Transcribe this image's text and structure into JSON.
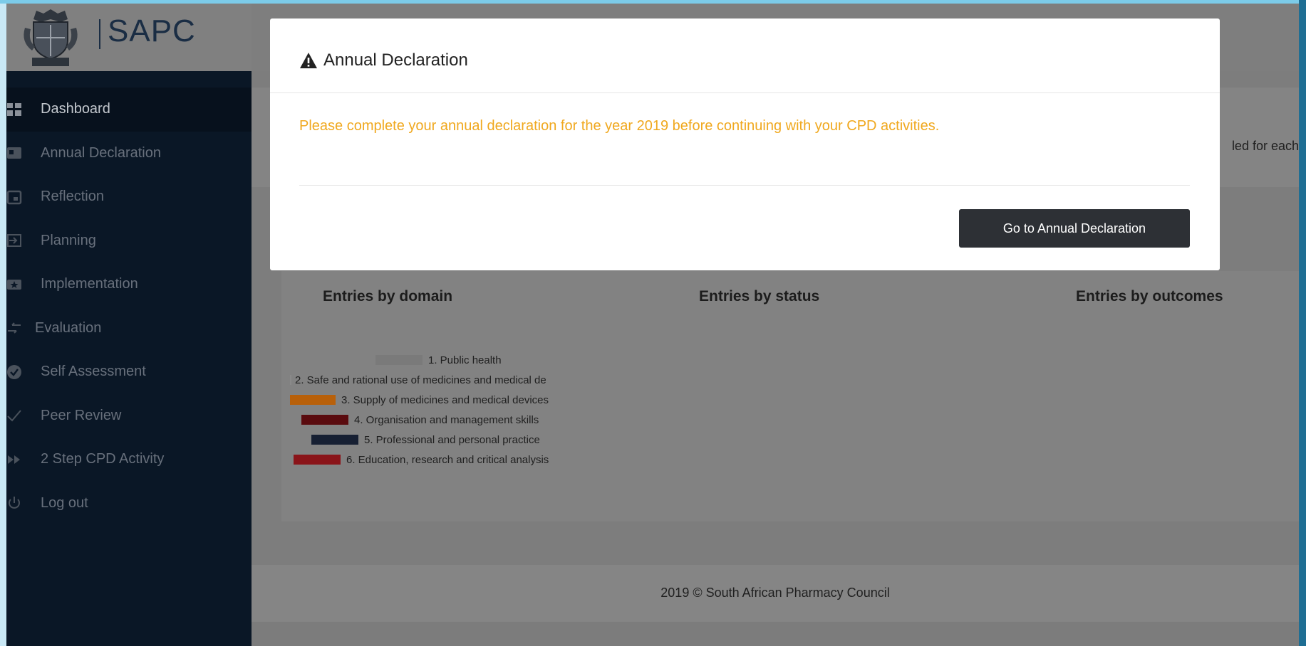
{
  "brand": {
    "name": "SAPC",
    "crest_text": "South African Pharmacy Council"
  },
  "sidebar": {
    "items": [
      {
        "label": "Dashboard",
        "icon": "grid-icon",
        "active": true
      },
      {
        "label": "Annual Declaration",
        "icon": "id-card-icon",
        "active": false
      },
      {
        "label": "Reflection",
        "icon": "calendar-icon",
        "active": false
      },
      {
        "label": "Planning",
        "icon": "sign-in-icon",
        "active": false
      },
      {
        "label": "Implementation",
        "icon": "star-icon",
        "active": false
      },
      {
        "label": "Evaluation",
        "icon": "exchange-icon",
        "active": false
      },
      {
        "label": "Self Assessment",
        "icon": "check-circle-icon",
        "active": false
      },
      {
        "label": "Peer Review",
        "icon": "check-icon",
        "active": false
      },
      {
        "label": "2 Step CPD Activity",
        "icon": "fast-forward-icon",
        "active": false
      },
      {
        "label": "Log out",
        "icon": "power-icon",
        "active": false
      }
    ]
  },
  "main": {
    "info_text_fragment": "led for each",
    "stats": {
      "domain_title": "Entries by domain",
      "status_title": "Entries by status",
      "outcomes_title": "Entries by outcomes"
    },
    "legend": [
      {
        "label": "1. Public health",
        "color": "#7a7a7a"
      },
      {
        "label": "2. Safe and rational use of medicines and medical de",
        "color": "#8a8a8a"
      },
      {
        "label": "3. Supply of medicines and medical devices",
        "color": "#b8600a"
      },
      {
        "label": "4. Organisation and management skills",
        "color": "#5a0b0f"
      },
      {
        "label": "5. Professional and personal practice",
        "color": "#172033"
      },
      {
        "label": "6. Education, research and critical analysis",
        "color": "#8a1419"
      }
    ],
    "footer": "2019 © South African Pharmacy Council"
  },
  "modal": {
    "title": "Annual Declaration",
    "message": "Please complete your annual declaration for the year 2019 before continuing with your CPD activities.",
    "button_label": "Go to Annual Declaration"
  }
}
